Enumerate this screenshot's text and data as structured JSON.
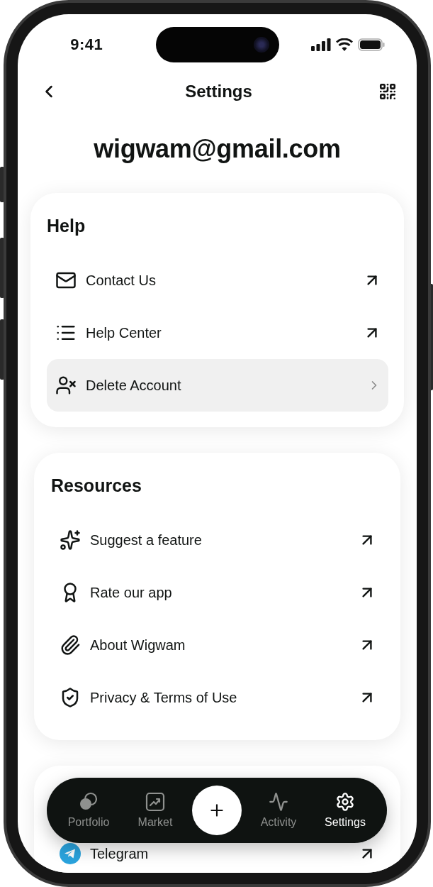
{
  "status_bar": {
    "time": "9:41"
  },
  "header": {
    "title": "Settings"
  },
  "account": {
    "email": "wigwam@gmail.com"
  },
  "sections": [
    {
      "title": "Help",
      "items": [
        {
          "label": "Contact Us",
          "kind": "external",
          "selected": false
        },
        {
          "label": "Help Center",
          "kind": "external",
          "selected": false
        },
        {
          "label": "Delete Account",
          "kind": "navigate",
          "selected": true
        }
      ]
    },
    {
      "title": "Resources",
      "items": [
        {
          "label": "Suggest a feature",
          "kind": "external",
          "selected": false
        },
        {
          "label": "Rate our app",
          "kind": "external",
          "selected": false
        },
        {
          "label": "About Wigwam",
          "kind": "external",
          "selected": false
        },
        {
          "label": "Privacy & Terms of Use",
          "kind": "external",
          "selected": false
        }
      ]
    },
    {
      "items": [
        {
          "label": "Telegram",
          "kind": "external",
          "selected": false
        }
      ]
    }
  ],
  "tab_bar": [
    {
      "kind": "tab",
      "label": "Portfolio",
      "selected": false
    },
    {
      "kind": "tab",
      "label": "Market",
      "selected": false
    },
    {
      "kind": "add"
    },
    {
      "kind": "tab",
      "label": "Activity",
      "selected": false
    },
    {
      "kind": "tab",
      "label": "Settings",
      "selected": true
    }
  ]
}
